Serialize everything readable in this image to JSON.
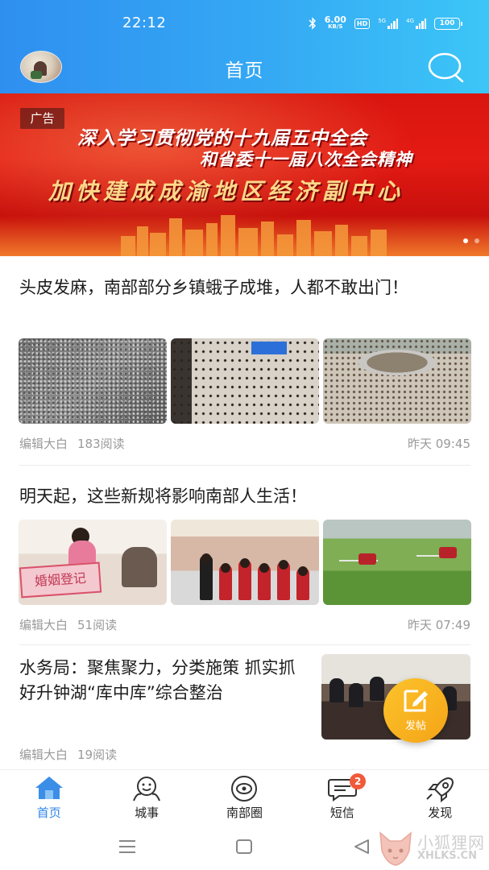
{
  "status_bar": {
    "time": "22:12",
    "net_speed_value": "6.00",
    "net_speed_unit": "KB/S",
    "hd_label": "HD",
    "signal1_label": "5G",
    "signal2_label": "4G",
    "battery": "100"
  },
  "header": {
    "title": "首页",
    "search_icon": "search-icon"
  },
  "banner": {
    "ad_tag": "广告",
    "line1": "深入学习贯彻党的十九届五中全会",
    "line2": "和省委十一届八次全会精神",
    "line3": "加快建成成渝地区经济副中心",
    "slides": 2,
    "active_slide": 1
  },
  "feed": [
    {
      "title": "头皮发麻，南部部分乡镇蛾子成堆，人都不敢出门！",
      "author": "编辑大白",
      "reads": "183阅读",
      "time": "昨天 09:45",
      "images": [
        "moths-pile",
        "moths-wall",
        "moths-basin"
      ]
    },
    {
      "title": "明天起，这些新规将影响南部人生活！",
      "author": "编辑大白",
      "reads": "51阅读",
      "time": "昨天 07:49",
      "images": [
        "marriage-office",
        "school-children",
        "field-spraying"
      ],
      "image_text": "婚姻登记"
    },
    {
      "title": "水务局：聚焦聚力，分类施策 抓实抓好升钟湖“库中库”综合整治",
      "author": "编辑大白",
      "reads": "19阅读",
      "images": [
        "meeting-room"
      ]
    }
  ],
  "fab": {
    "label": "发帖",
    "icon": "edit-icon"
  },
  "tabbar": {
    "items": [
      {
        "label": "首页",
        "icon": "home-icon",
        "active": true
      },
      {
        "label": "城事",
        "icon": "city-icon"
      },
      {
        "label": "南部圈",
        "icon": "circle-icon"
      },
      {
        "label": "短信",
        "icon": "message-icon",
        "badge": "2"
      },
      {
        "label": "发现",
        "icon": "rocket-icon"
      }
    ]
  },
  "system_nav": {
    "menu": "menu-icon",
    "home": "home-square-icon",
    "back": "back-icon"
  },
  "watermark": {
    "cn": "小狐狸网",
    "en": "XHLKS.CN"
  },
  "colors": {
    "header_blue": "#2f8ff0",
    "active_tab": "#2e86e6",
    "banner_red": "#d9150f",
    "fab_yellow": "#f5a417",
    "badge_red": "#f05a3a"
  }
}
